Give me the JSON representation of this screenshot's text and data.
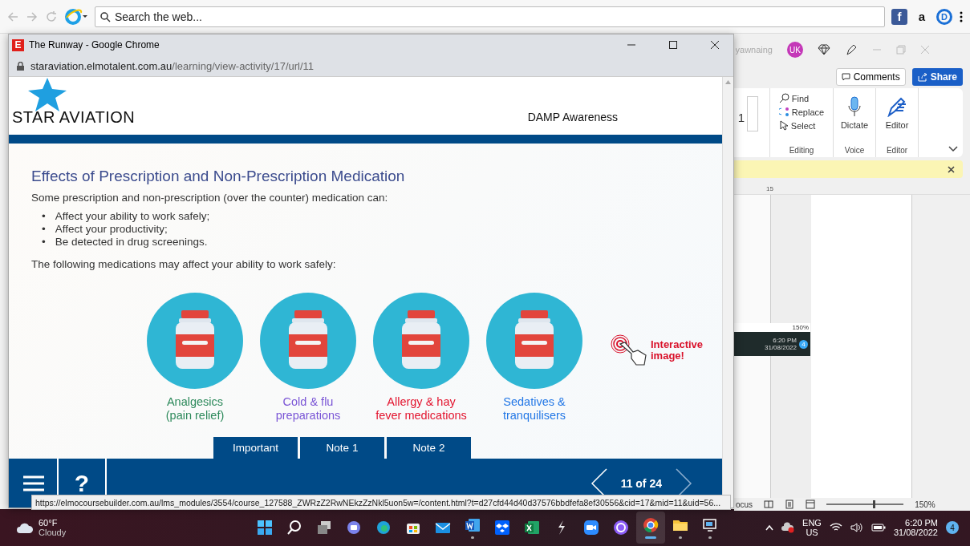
{
  "browser_toolbar": {
    "search": {
      "placeholder": "Search the web..."
    },
    "extensions": [
      {
        "kind": "facebook",
        "glyph": "f"
      },
      {
        "kind": "amazon",
        "glyph": "a"
      },
      {
        "kind": "ring",
        "glyph": "D"
      }
    ]
  },
  "popup_window": {
    "favicon": "E",
    "title": "The Runway - Google Chrome",
    "url_host": "staraviation.elmotalent.com.au",
    "url_path": "/learning/view-activity/17/url/11",
    "course": {
      "logo": "STAR AVIATION",
      "module": "DAMP Awareness",
      "heading": "Effects of Prescription and Non-Prescription Medication",
      "intro": "Some prescription and non-prescription (over the counter) medication can:",
      "bullets": [
        {
          "marker": "•",
          "text": "Affect your ability to work safely;"
        },
        {
          "marker": "•",
          "text": "Affect your productivity;"
        },
        {
          "marker": "•",
          "text": "Be detected in drug screenings."
        }
      ],
      "lead": "The following medications may affect your ability to work safely:",
      "medications": [
        {
          "label": "Analgesics\n(pain relief)",
          "color": "#2e8a5c"
        },
        {
          "label": "Cold & flu\npreparations",
          "color": "#7a55d6"
        },
        {
          "label": "Allergy & hay\nfever medications",
          "color": "#e3152f"
        },
        {
          "label": "Sedatives &\ntranquilisers",
          "color": "#2478e6"
        }
      ],
      "hint": "Interactive\nimage!",
      "tabs": [
        "Important",
        "Note 1",
        "Note 2"
      ],
      "help": "?",
      "page": "11 of 24"
    },
    "status_url": "https://elmocoursebuilder.com.au/lms_modules/3554/course_127588_ZWRzZ2RwNEkzZzNkl5uon5w=/content.html?t=d27cfd44d40d37576bbdfefa8ef30556&cid=17&mid=11&uid=56..."
  },
  "word_window": {
    "user": "yawnaing",
    "avatar": "UK",
    "comments": "Comments",
    "share": "Share",
    "font_size": "1",
    "editing": {
      "find": "Find",
      "replace": "Replace",
      "select": "Select",
      "label": "Editing"
    },
    "voice": {
      "button": "Dictate",
      "label": "Voice"
    },
    "editor": {
      "button": "Editor",
      "label": "Editor"
    },
    "ruler_mark": "15",
    "embedded_screenshot": {
      "zoom": "150%",
      "time": "6:20 PM",
      "date": "31/08/2022",
      "badge": "4"
    },
    "status": {
      "focus": "ocus",
      "zoom": "150%",
      "zoom_slider": {
        "level": 0.6
      }
    }
  },
  "taskbar": {
    "weather": {
      "temp": "60°F",
      "condition": "Cloudy"
    },
    "apps": [
      {
        "kind": "start",
        "running": false,
        "selected": false
      },
      {
        "kind": "search",
        "running": false,
        "selected": false
      },
      {
        "kind": "task-view",
        "running": false,
        "selected": false
      },
      {
        "kind": "chat",
        "running": false,
        "selected": false
      },
      {
        "kind": "edge",
        "running": false,
        "selected": false
      },
      {
        "kind": "store",
        "running": false,
        "selected": false
      },
      {
        "kind": "mail",
        "running": false,
        "selected": false
      },
      {
        "kind": "word",
        "running": true,
        "selected": false
      },
      {
        "kind": "dropbox",
        "running": false,
        "selected": false
      },
      {
        "kind": "excel",
        "running": false,
        "selected": false
      },
      {
        "kind": "bolt",
        "running": false,
        "selected": false
      },
      {
        "kind": "zoom",
        "running": false,
        "selected": false
      },
      {
        "kind": "ring-app",
        "running": false,
        "selected": false
      },
      {
        "kind": "chrome",
        "running": true,
        "selected": true
      },
      {
        "kind": "explorer",
        "running": true,
        "selected": false
      },
      {
        "kind": "remote",
        "running": true,
        "selected": false
      }
    ],
    "language": "ENG",
    "region": "US",
    "time": "6:20 PM",
    "date": "31/08/2022",
    "badge": "4"
  }
}
